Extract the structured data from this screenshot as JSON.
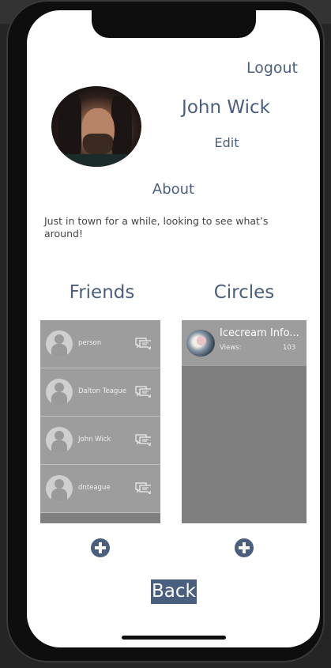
{
  "header": {
    "logout_label": "Logout"
  },
  "profile": {
    "name": "John Wick",
    "edit_label": "Edit",
    "avatar_icon": "profile-photo"
  },
  "about": {
    "heading": "About",
    "text": "Just in town for a while, looking to see what’s around!"
  },
  "friends": {
    "heading": "Friends",
    "items": [
      {
        "name": "person"
      },
      {
        "name": "Dalton Teague"
      },
      {
        "name": "John Wick"
      },
      {
        "name": "dnteague"
      }
    ]
  },
  "circles": {
    "heading": "Circles",
    "items": [
      {
        "name": "Icecream Info...",
        "views_label": "Views:",
        "views": "103"
      }
    ]
  },
  "footer": {
    "back_label": "Back"
  },
  "colors": {
    "accent": "#4a5f7d",
    "panel": "#7f7f7f",
    "row": "#9d9d9d"
  }
}
